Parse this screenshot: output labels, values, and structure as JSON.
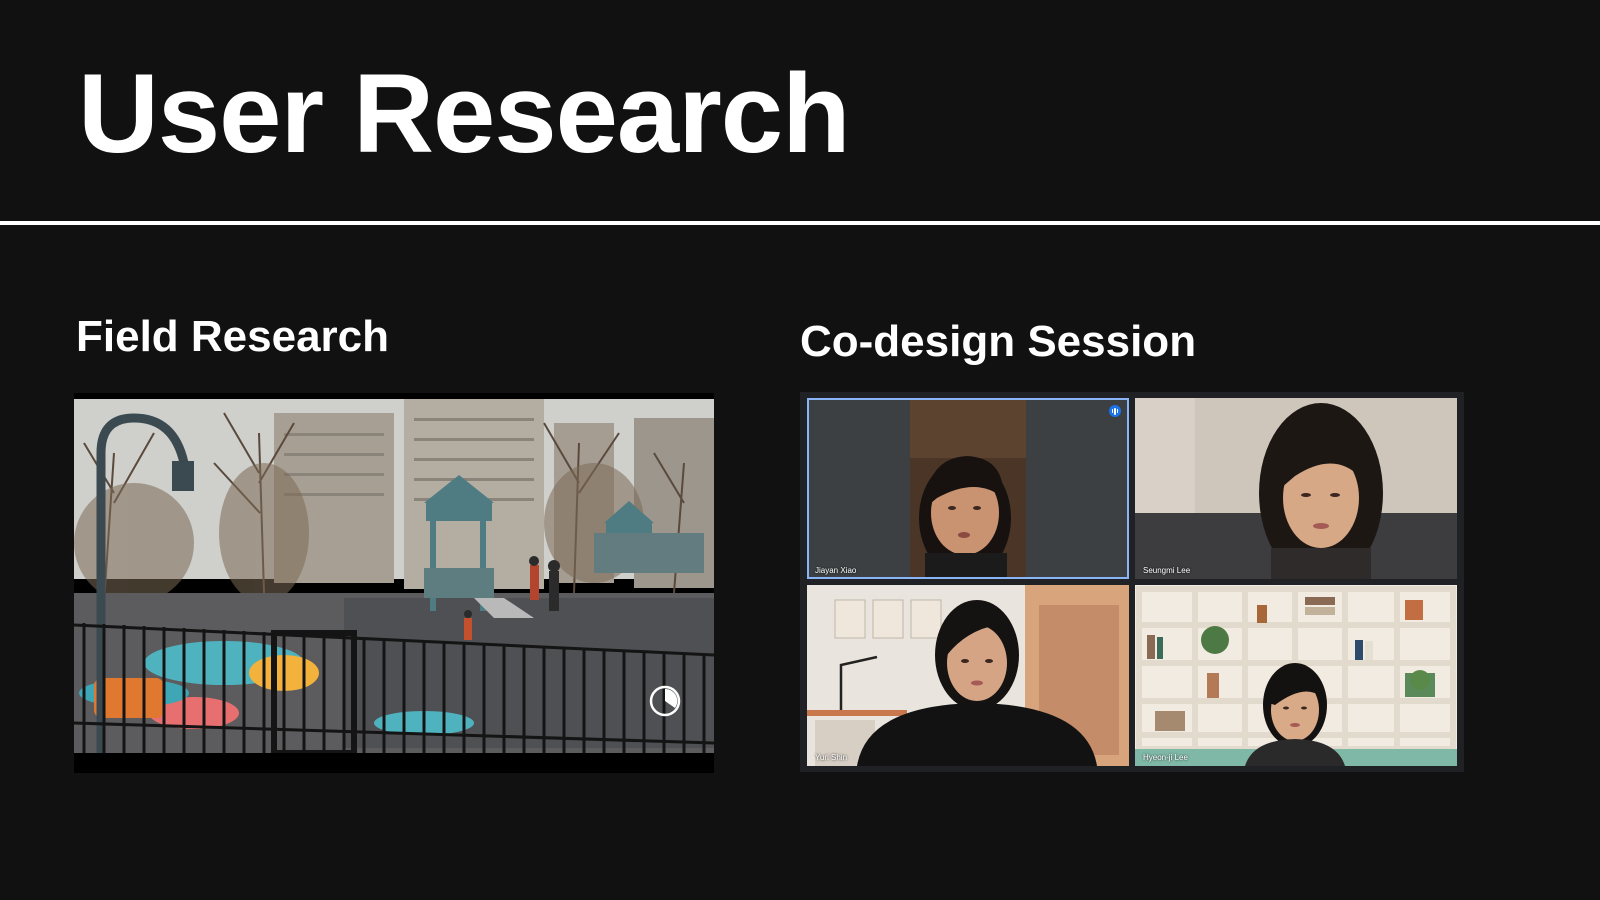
{
  "slide": {
    "title": "User Research"
  },
  "field_research": {
    "title": "Field Research"
  },
  "codesign": {
    "title": "Co-design Session",
    "participants": [
      {
        "name": "Jiayan Xiao",
        "speaking": true
      },
      {
        "name": "Seungmi Lee",
        "speaking": false
      },
      {
        "name": "Yuri Shin",
        "speaking": false
      },
      {
        "name": "Hyeon-ji Lee",
        "speaking": false
      }
    ]
  },
  "colors": {
    "background": "#111111",
    "text": "#ffffff",
    "active_speaker": "#8ab4f8"
  }
}
